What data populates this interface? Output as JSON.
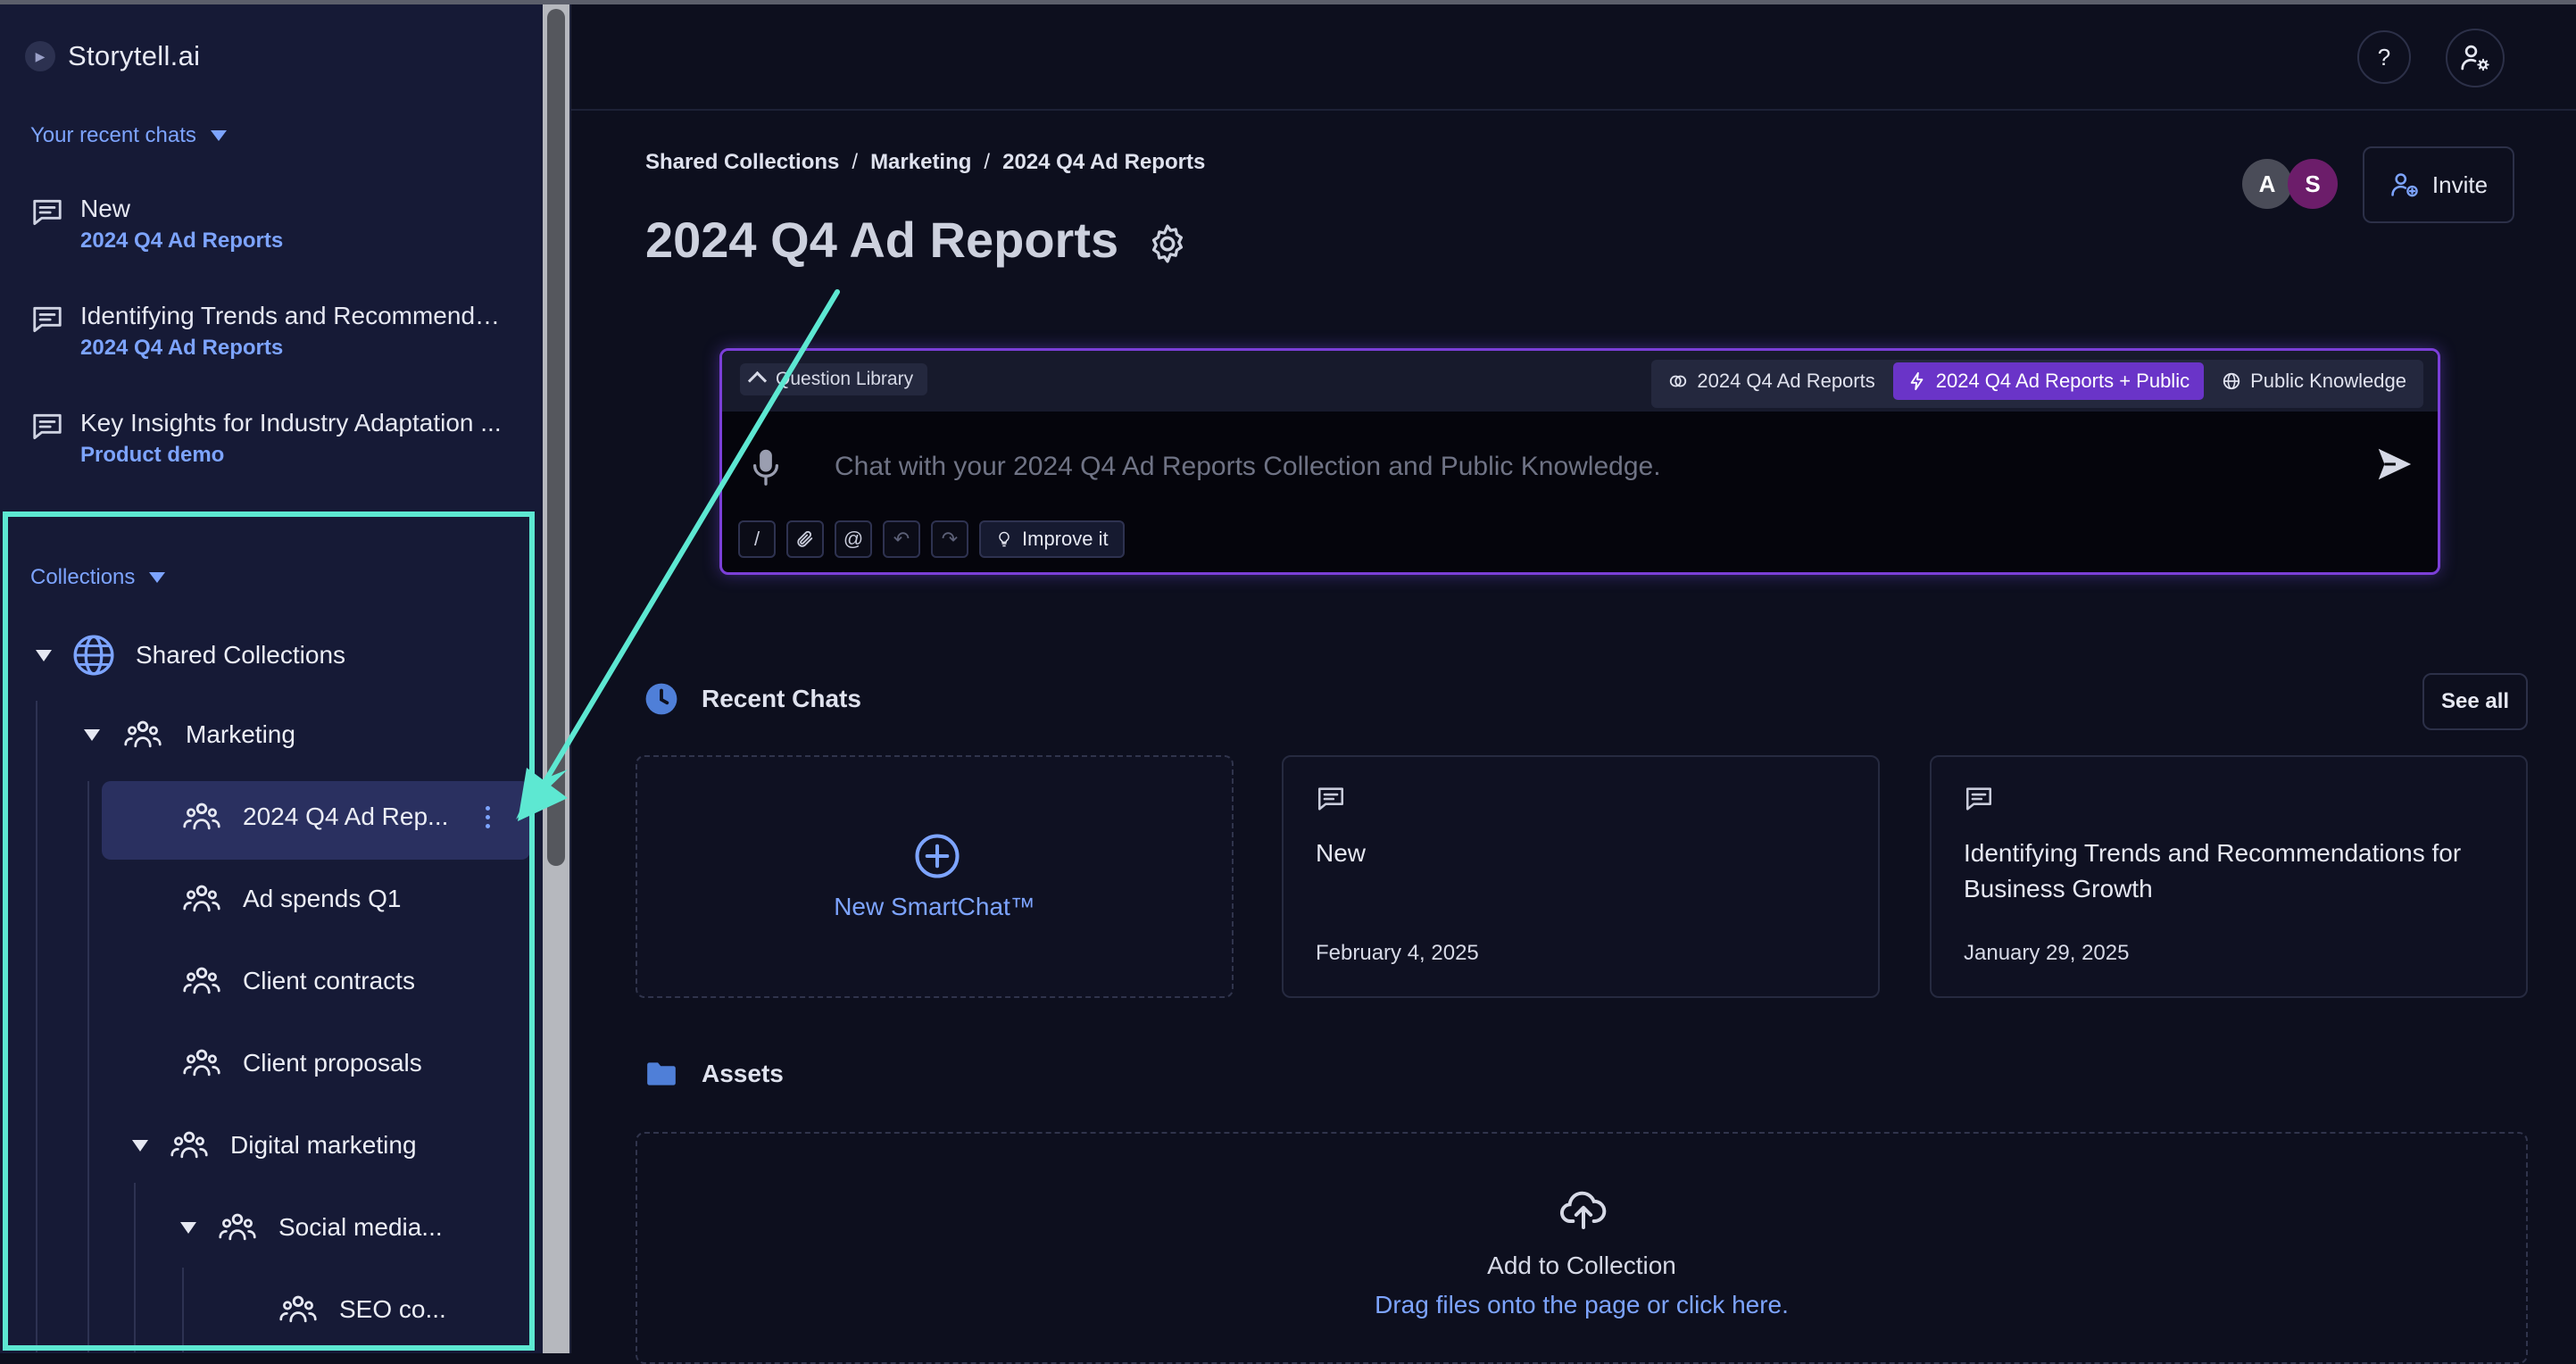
{
  "app": {
    "name": "Storytell.ai"
  },
  "sidebar": {
    "recent_toggle": "Your recent chats",
    "recent_chats": [
      {
        "title": "New",
        "collection": "2024 Q4 Ad Reports"
      },
      {
        "title": "Identifying Trends and Recommenda...",
        "collection": "2024 Q4 Ad Reports"
      },
      {
        "title": "Key Insights for Industry Adaptation ...",
        "collection": "Product demo"
      }
    ],
    "collections_toggle": "Collections",
    "tree": [
      {
        "label": "Shared Collections",
        "icon": "globe-icon"
      },
      {
        "label": "Marketing",
        "icon": "group-icon"
      },
      {
        "label": "2024 Q4 Ad Rep...",
        "icon": "group-icon",
        "selected": true
      },
      {
        "label": "Ad spends Q1",
        "icon": "group-icon"
      },
      {
        "label": "Client contracts",
        "icon": "group-icon"
      },
      {
        "label": "Client proposals",
        "icon": "group-icon"
      },
      {
        "label": "Digital marketing",
        "icon": "group-icon"
      },
      {
        "label": "Social media...",
        "icon": "group-icon"
      },
      {
        "label": "SEO co...",
        "icon": "group-icon"
      }
    ]
  },
  "header": {
    "help_label": "?"
  },
  "breadcrumb": {
    "items": [
      "Shared Collections",
      "Marketing",
      "2024 Q4 Ad Reports"
    ],
    "separator": "/"
  },
  "page": {
    "title": "2024 Q4 Ad Reports"
  },
  "members": [
    {
      "initial": "A",
      "color": "#4a4c58"
    },
    {
      "initial": "S",
      "color": "#6c1d6a"
    }
  ],
  "invite": {
    "label": "Invite"
  },
  "chat": {
    "question_library": "Question Library",
    "scopes": [
      {
        "label": "2024 Q4 Ad Reports",
        "icon": "collection-icon"
      },
      {
        "label": "2024 Q4 Ad Reports + Public",
        "icon": "bolt-icon",
        "active": true
      },
      {
        "label": "Public Knowledge",
        "icon": "globe-icon"
      }
    ],
    "placeholder": "Chat with your 2024 Q4 Ad Reports Collection and Public Knowledge.",
    "value": "",
    "tools": {
      "slash": "/",
      "at": "@",
      "undo": "↶",
      "redo": "↷"
    },
    "improve_label": "Improve it"
  },
  "recent_section": {
    "title": "Recent Chats",
    "see_all": "See all",
    "new_chat_label": "New SmartChat™",
    "cards": [
      {
        "title": "New",
        "date": "February 4, 2025"
      },
      {
        "title": "Identifying Trends and Recommendations for Business Growth",
        "date": "January 29, 2025"
      }
    ]
  },
  "assets_section": {
    "title": "Assets",
    "dropzone_title": "Add to Collection",
    "dropzone_link": "Drag files onto the page or click here."
  },
  "colors": {
    "accent": "#7da4ff",
    "highlight": "#5de8d2",
    "chat_border": "#7b3fd8",
    "active_scope": "#6a34c8"
  }
}
